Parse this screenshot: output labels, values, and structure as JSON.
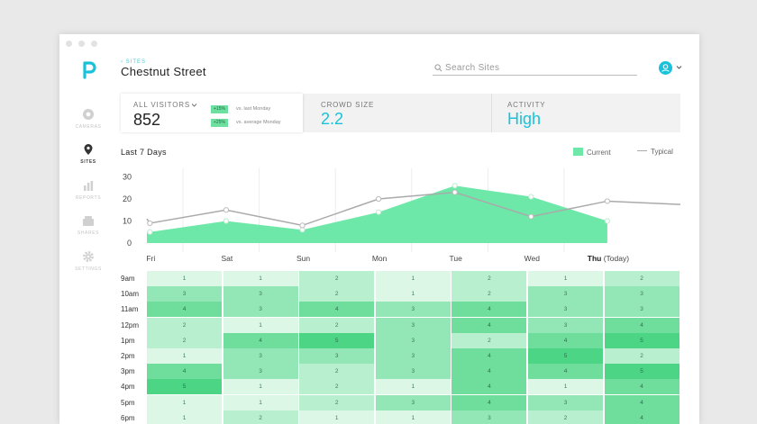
{
  "nav": {
    "items": [
      {
        "label": "CAMERAS"
      },
      {
        "label": "SITES"
      },
      {
        "label": "REPORTS"
      },
      {
        "label": "SHARES"
      },
      {
        "label": "SETTINGS"
      }
    ]
  },
  "header": {
    "back_label": "‹  SITES",
    "title": "Chestnut Street",
    "search_placeholder": "Search Sites"
  },
  "stats": {
    "visitors_label": "ALL VISITORS",
    "visitors_value": "852",
    "change1_badge": "+15%",
    "change1_text": "vs. last Monday",
    "change2_badge": "+25%",
    "change2_text": "vs. average Monday",
    "crowd_label": "CROWD SIZE",
    "crowd_value": "2.2",
    "activity_label": "ACTIVITY",
    "activity_value": "High"
  },
  "colors": {
    "accent": "#19c2da",
    "current": "#6de8a8",
    "typical": "#aaaaaa",
    "heat_levels": [
      "#ffffff",
      "#dcf7e6",
      "#b8efcf",
      "#93e6b6",
      "#6fde9d",
      "#4bd585"
    ]
  },
  "chart_data": {
    "type": "area",
    "title": "Last 7 Days",
    "categories": [
      "Fri",
      "Sat",
      "Sun",
      "Mon",
      "Tue",
      "Wed",
      "Thu (Today)"
    ],
    "ylim": [
      0,
      30
    ],
    "yticks": [
      "30",
      "20",
      "10",
      "0"
    ],
    "series": [
      {
        "name": "Current",
        "values": [
          5,
          10,
          6,
          14,
          26,
          21,
          10
        ]
      },
      {
        "name": "Typical",
        "values": [
          9,
          15,
          8,
          20,
          23,
          12,
          19
        ]
      }
    ],
    "grid": true,
    "legend": "top-right"
  },
  "heatmap": {
    "hours": [
      "9am",
      "10am",
      "11am",
      "12pm",
      "1pm",
      "2pm",
      "3pm",
      "4pm",
      "5pm",
      "6pm"
    ],
    "values": [
      [
        1,
        1,
        2,
        1,
        2,
        1,
        2
      ],
      [
        3,
        3,
        2,
        1,
        2,
        3,
        3
      ],
      [
        4,
        3,
        4,
        3,
        4,
        3,
        3
      ],
      [
        2,
        1,
        2,
        3,
        4,
        3,
        4
      ],
      [
        2,
        4,
        5,
        3,
        2,
        4,
        5
      ],
      [
        1,
        3,
        3,
        3,
        4,
        5,
        2
      ],
      [
        4,
        3,
        2,
        3,
        4,
        4,
        5
      ],
      [
        5,
        1,
        2,
        1,
        4,
        1,
        4
      ],
      [
        1,
        1,
        2,
        3,
        4,
        3,
        4
      ],
      [
        1,
        2,
        1,
        1,
        3,
        2,
        4
      ]
    ]
  }
}
